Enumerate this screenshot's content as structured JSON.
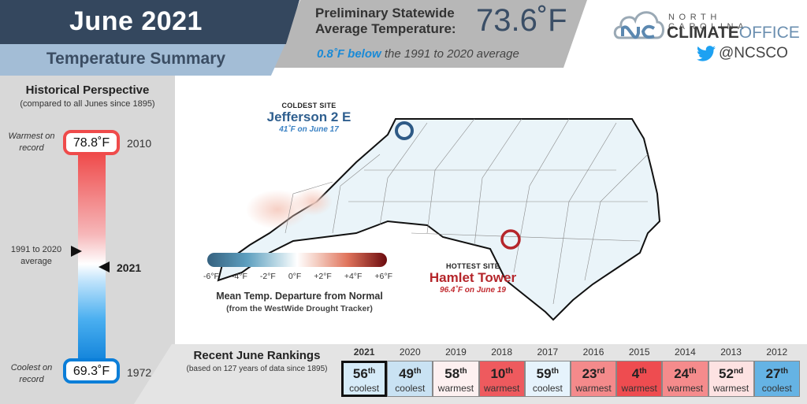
{
  "header": {
    "title": "June 2021",
    "subtitle": "Temperature Summary",
    "stat_label_line1": "Preliminary Statewide",
    "stat_label_line2": "Average Temperature:",
    "stat_value": "73.6˚F",
    "stat_note_highlight": "0.8˚F below",
    "stat_note_rest": " the 1991 to 2020 average",
    "colors": {
      "dark": "#34475e",
      "light": "#a3bdd6",
      "grey": "#b7b7b7",
      "highlight": "#1a8ad6"
    }
  },
  "logo": {
    "icon": "cloud-nc-logo-icon",
    "line1": "NORTH CAROLINA",
    "line2_bold": "CLIMATE",
    "line2_thin": "OFFICE",
    "twitter_icon": "twitter-bird-icon",
    "twitter_handle": "@NCSCO"
  },
  "historical": {
    "title": "Historical Perspective",
    "subtitle": "(compared to all Junes since 1895)",
    "warmest": {
      "label": "Warmest on record",
      "value": "78.8˚F",
      "year": "2010",
      "value_f": 78.8
    },
    "coolest": {
      "label": "Coolest on record",
      "value": "69.3˚F",
      "year": "1972",
      "value_f": 69.3
    },
    "average": {
      "label_line1": "1991 to 2020",
      "label_line2": "average",
      "value_f": 74.4
    },
    "current": {
      "label": "2021",
      "value_f": 73.6
    }
  },
  "map": {
    "coldest": {
      "kicker": "COLDEST SITE",
      "name": "Jefferson 2 E",
      "note": "41˚F on June 17",
      "marker_color": "#2e5a86"
    },
    "hottest": {
      "kicker": "HOTTEST SITE",
      "name": "Hamlet Tower",
      "note": "96.4˚F on June 19",
      "marker_color": "#b5262b"
    },
    "legend": {
      "ticks": [
        "-6°F",
        "-4°F",
        "-2°F",
        "0°F",
        "+2°F",
        "+4°F",
        "+6°F"
      ],
      "title": "Mean Temp. Departure from Normal",
      "subtitle": "(from the WestWide Drought Tracker)"
    }
  },
  "rankings": {
    "title": "Recent June Rankings",
    "subtitle": "(based on 127 years of data since 1895)",
    "items": [
      {
        "year": "2021",
        "rank": "56",
        "suffix": "th",
        "word": "coolest",
        "color": "#d6ebf8",
        "current": true
      },
      {
        "year": "2020",
        "rank": "49",
        "suffix": "th",
        "word": "coolest",
        "color": "#c9e2f3",
        "current": false
      },
      {
        "year": "2019",
        "rank": "58",
        "suffix": "th",
        "word": "warmest",
        "color": "#fdf0f0",
        "current": false
      },
      {
        "year": "2018",
        "rank": "10",
        "suffix": "th",
        "word": "warmest",
        "color": "#ee5a5e",
        "current": false
      },
      {
        "year": "2017",
        "rank": "59",
        "suffix": "th",
        "word": "coolest",
        "color": "#e6f3fc",
        "current": false
      },
      {
        "year": "2016",
        "rank": "23",
        "suffix": "rd",
        "word": "warmest",
        "color": "#f48a8b",
        "current": false
      },
      {
        "year": "2015",
        "rank": "4",
        "suffix": "th",
        "word": "warmest",
        "color": "#ee4c50",
        "current": false
      },
      {
        "year": "2014",
        "rank": "24",
        "suffix": "th",
        "word": "warmest",
        "color": "#f58b8c",
        "current": false
      },
      {
        "year": "2013",
        "rank": "52",
        "suffix": "nd",
        "word": "warmest",
        "color": "#fde2e2",
        "current": false
      },
      {
        "year": "2012",
        "rank": "27",
        "suffix": "th",
        "word": "coolest",
        "color": "#65b3e4",
        "current": false
      }
    ]
  }
}
